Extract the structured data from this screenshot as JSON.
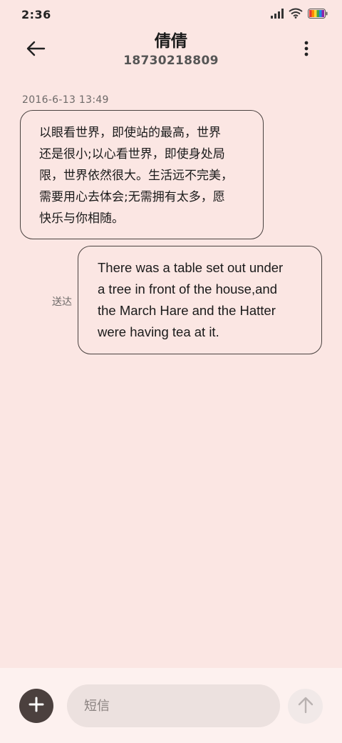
{
  "status_bar": {
    "time": "2:36",
    "icons": [
      "signal-icon",
      "wifi-icon",
      "battery-icon"
    ]
  },
  "header": {
    "contact_name": "倩倩",
    "contact_number": "18730218809",
    "back_icon": "back-arrow-icon",
    "more_icon": "more-vertical-icon"
  },
  "conversation": {
    "timestamp": "2016-6-13 13:49",
    "incoming": {
      "lines": [
        "以眼看世界，即使站的最高，世界",
        "还是很小;以心看世界，即使身处局",
        "限，世界依然很大。生活远不完美，",
        "需要用心去体会;无需拥有太多，愿",
        "快乐与你相随。"
      ]
    },
    "outgoing": {
      "status": "送达",
      "lines": [
        "There was a table set out under",
        "a tree in front of the house,and",
        "the March Hare and the Hatter",
        "were having tea at it."
      ]
    }
  },
  "composer": {
    "placeholder": "短信",
    "value": "",
    "attach_icon": "plus-icon",
    "send_icon": "send-arrow-icon"
  },
  "colors": {
    "background": "#fbe6e3",
    "bubble_border": "#4a4240",
    "attach_button": "#4b403e",
    "input_background": "#ece1df"
  }
}
